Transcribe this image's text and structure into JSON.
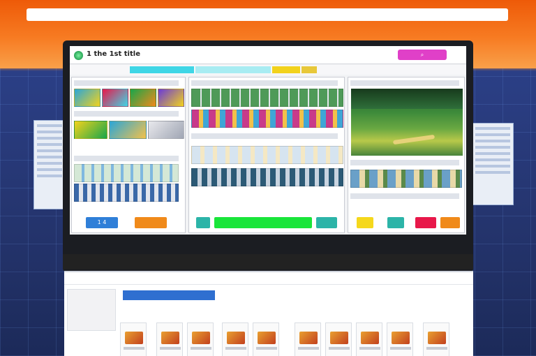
{
  "banner": {
    "title": ""
  },
  "site": {
    "name": "1 the 1st title"
  },
  "nav": {
    "label": ""
  },
  "colors": {
    "banner_orange": "#f26a12",
    "search_button": "#e040c8",
    "accent_blue": "#2f6fd0",
    "button_blue": "#2f7fd8",
    "button_orange": "#f08a1a",
    "button_green": "#19e53a",
    "button_teal": "#2cb4a8",
    "button_red": "#e8184a",
    "button_yellow": "#f5d81c"
  },
  "icons": [
    "logo-icon",
    "search-icon"
  ],
  "buttons": {
    "b1": "1 4",
    "b4": "",
    "b5": ""
  },
  "footer": {
    "item1": "",
    "item2": "",
    "item3": "",
    "item4": "",
    "item5": ""
  },
  "shop": {
    "title": "",
    "side_title": "",
    "tab": "",
    "line": ""
  }
}
